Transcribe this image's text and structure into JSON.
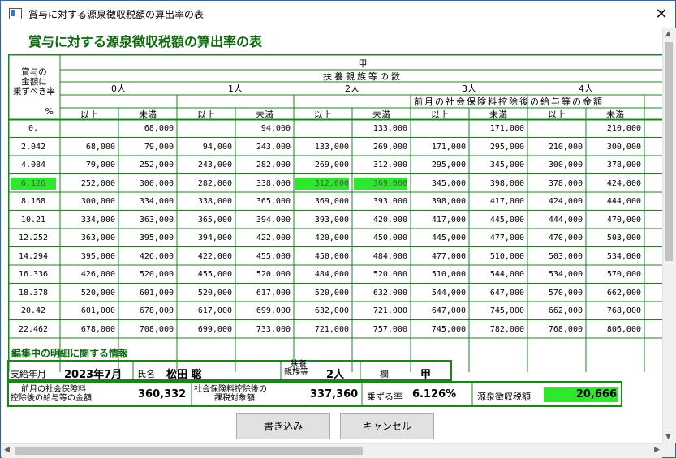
{
  "window": {
    "title": "賞与に対する源泉徴収税額の算出率の表",
    "close": "✕"
  },
  "heading": "賞与に対する源泉徴収税額の算出率の表",
  "table": {
    "col_header_main": "甲",
    "row_header_lines": [
      "賞与の",
      "金額に",
      "乗ずべき率"
    ],
    "percent_unit": "%",
    "dependents_header": "扶養親族等の数",
    "dependent_groups": [
      "0人",
      "1人",
      "2人",
      "3人",
      "4人"
    ],
    "salary_header": "前月の社会保険料控除後の給与等の金額",
    "sub_headers": [
      "以上",
      "未満"
    ],
    "rows": [
      {
        "rate": "0.",
        "cells": [
          "",
          "68,000",
          "",
          "94,000",
          "",
          "133,000",
          "",
          "171,000",
          "",
          "210,000"
        ]
      },
      {
        "rate": "2.042",
        "cells": [
          "68,000",
          "79,000",
          "94,000",
          "243,000",
          "133,000",
          "269,000",
          "171,000",
          "295,000",
          "210,000",
          "300,000"
        ]
      },
      {
        "rate": "4.084",
        "cells": [
          "79,000",
          "252,000",
          "243,000",
          "282,000",
          "269,000",
          "312,000",
          "295,000",
          "345,000",
          "300,000",
          "378,000"
        ]
      },
      {
        "rate": "6.126",
        "cells": [
          "252,000",
          "300,000",
          "282,000",
          "338,000",
          "312,000",
          "369,000",
          "345,000",
          "398,000",
          "378,000",
          "424,000"
        ]
      },
      {
        "rate": "8.168",
        "cells": [
          "300,000",
          "334,000",
          "338,000",
          "365,000",
          "369,000",
          "393,000",
          "398,000",
          "417,000",
          "424,000",
          "444,000"
        ]
      },
      {
        "rate": "10.21",
        "cells": [
          "334,000",
          "363,000",
          "365,000",
          "394,000",
          "393,000",
          "420,000",
          "417,000",
          "445,000",
          "444,000",
          "470,000"
        ]
      },
      {
        "rate": "12.252",
        "cells": [
          "363,000",
          "395,000",
          "394,000",
          "422,000",
          "420,000",
          "450,000",
          "445,000",
          "477,000",
          "470,000",
          "503,000"
        ]
      },
      {
        "rate": "14.294",
        "cells": [
          "395,000",
          "426,000",
          "422,000",
          "455,000",
          "450,000",
          "484,000",
          "477,000",
          "510,000",
          "503,000",
          "534,000"
        ]
      },
      {
        "rate": "16.336",
        "cells": [
          "426,000",
          "520,000",
          "455,000",
          "520,000",
          "484,000",
          "520,000",
          "510,000",
          "544,000",
          "534,000",
          "570,000"
        ]
      },
      {
        "rate": "18.378",
        "cells": [
          "520,000",
          "601,000",
          "520,000",
          "617,000",
          "520,000",
          "632,000",
          "544,000",
          "647,000",
          "570,000",
          "662,000"
        ]
      },
      {
        "rate": "20.42",
        "cells": [
          "601,000",
          "678,000",
          "617,000",
          "699,000",
          "632,000",
          "721,000",
          "647,000",
          "745,000",
          "662,000",
          "768,000"
        ]
      },
      {
        "rate": "22.462",
        "cells": [
          "678,000",
          "708,000",
          "699,000",
          "733,000",
          "721,000",
          "757,000",
          "745,000",
          "782,000",
          "768,000",
          "806,000"
        ]
      }
    ],
    "highlight": {
      "row_index": 3,
      "rate_highlighted": true,
      "highlighted_cells": [
        4,
        5
      ]
    }
  },
  "info": {
    "section_title": "編集中の明細に関する情報",
    "payment_month_label": "支給年月",
    "payment_month_value": "2023年7月",
    "name_label": "氏名",
    "name_value": "松田 聡",
    "dependents_label": [
      "扶養",
      "親族等"
    ],
    "dependents_value": "2人",
    "column_label": "欄",
    "column_value": "甲",
    "prev_salary_label": [
      "前月の社会保険料",
      "控除後の給与等の金額"
    ],
    "prev_salary_value": "360,332",
    "taxable_label": [
      "社会保険料控除後の",
      "課税対象額"
    ],
    "taxable_value": "337,360",
    "rate_label": "乗ずる率",
    "rate_value": "6.126%",
    "tax_label": "源泉徴収税額",
    "tax_value": "20,666"
  },
  "buttons": {
    "write": "書き込み",
    "cancel": "キャンセル"
  },
  "colors": {
    "accent_green": "#0d6a0d",
    "highlight": "#2ee82e",
    "border_green": "#138a13"
  }
}
